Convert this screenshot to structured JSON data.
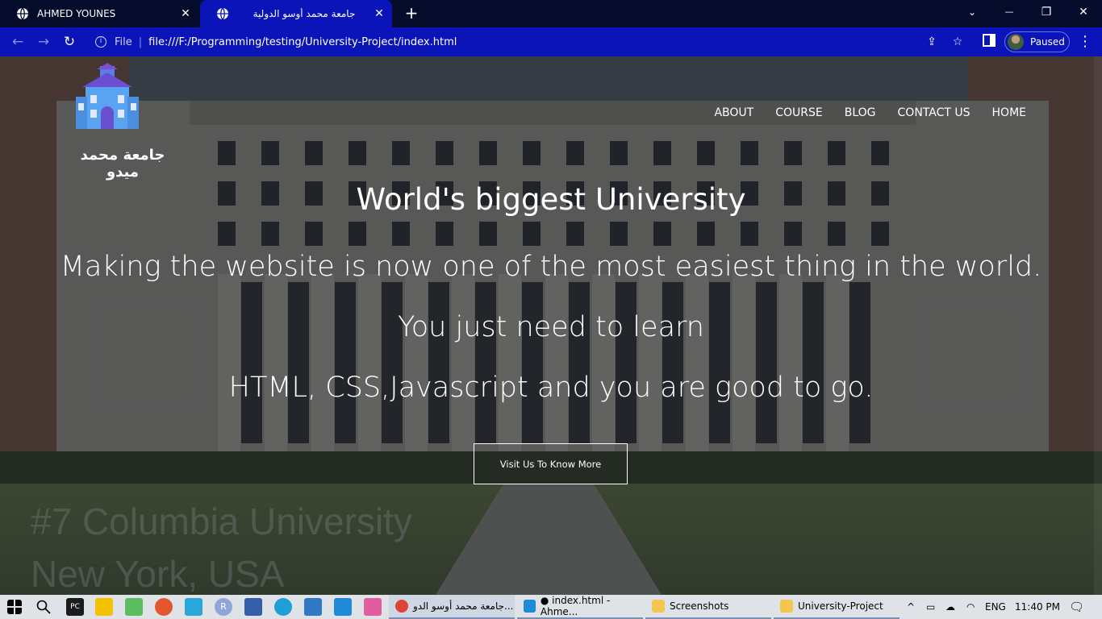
{
  "browser": {
    "tabs": [
      {
        "title": "AHMED YOUNES",
        "active": false
      },
      {
        "title": "جامعة محمد أوسو الدولية",
        "active": true
      }
    ],
    "new_tab_symbol": "+",
    "window_controls": {
      "dropdown": "⌄",
      "minimize": "—",
      "restore": "❐",
      "close": "✕"
    },
    "nav": {
      "back": "←",
      "forward": "→",
      "reload": "↻"
    },
    "address": {
      "scheme_label": "File",
      "url": "file:///F:/Programming/testing/University-Project/index.html"
    },
    "profile_status": "Paused",
    "menu_symbol": "⋮"
  },
  "page": {
    "logo_text": "جامعة محمد ميدو",
    "nav_links": [
      "ABOUT",
      "COURSE",
      "BLOG",
      "CONTACT US",
      "HOME"
    ],
    "hero_title": "World's biggest University",
    "hero_text_line1": "Making the website is now one of the most easiest thing in the world. You just need to learn",
    "hero_text_line2": "HTML, CSS,Javascript and you are good to go.",
    "cta_label": "Visit Us To Know More",
    "background_caption_line1": "#7 Columbia University",
    "background_caption_line2": "New York, USA"
  },
  "taskbar": {
    "tasks": [
      {
        "label": "جامعة محمد أوسو الدو...",
        "icon": "chrome-icon"
      },
      {
        "label": "● index.html - Ahme...",
        "icon": "vscode-icon"
      },
      {
        "label": "Screenshots",
        "icon": "folder-icon"
      },
      {
        "label": "University-Project",
        "icon": "folder-icon"
      }
    ],
    "tray": {
      "language": "ENG",
      "time": "11:40 PM",
      "chevron": "^"
    }
  },
  "colors": {
    "tab_strip": "#050b2a",
    "toolbar": "#0a14b8",
    "overlay_text": "#ffffff",
    "taskbar": "#dfe3e8"
  }
}
